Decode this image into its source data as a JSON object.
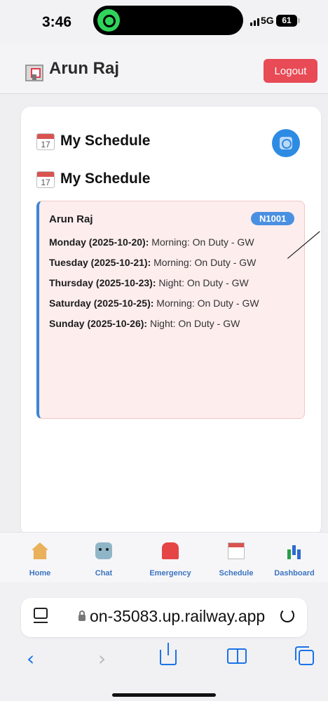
{
  "status_bar": {
    "time": "3:46",
    "network": "5G",
    "battery": "61"
  },
  "header": {
    "user_name": "Arun Raj",
    "logout_label": "Logout"
  },
  "schedule": {
    "title": "My Schedule",
    "subtitle": "My Schedule",
    "calendar_icon_day": "17",
    "employee_name": "Arun Raj",
    "employee_id": "N1001",
    "entries": [
      {
        "day": "Monday (2025-10-20):",
        "shift": " Morning: On Duty - GW"
      },
      {
        "day": "Tuesday (2025-10-21):",
        "shift": " Morning: On Duty - GW"
      },
      {
        "day": "Thursday (2025-10-23):",
        "shift": " Night: On Duty - GW"
      },
      {
        "day": "Saturday (2025-10-25):",
        "shift": " Morning: On Duty - GW"
      },
      {
        "day": "Sunday (2025-10-26):",
        "shift": " Night: On Duty - GW"
      }
    ]
  },
  "tabbar": {
    "items": [
      {
        "label": "Home",
        "icon": "house-icon"
      },
      {
        "label": "Chat",
        "icon": "robot-icon"
      },
      {
        "label": "Emergency",
        "icon": "siren-icon"
      },
      {
        "label": "Schedule",
        "icon": "calendar-icon"
      },
      {
        "label": "Dashboard",
        "icon": "bar-chart-icon"
      }
    ]
  },
  "browser": {
    "url": "on-35083.up.railway.app"
  },
  "colors": {
    "accent": "#3c86d6",
    "logout": "#e84a56",
    "entry_bg": "#fdeded"
  }
}
